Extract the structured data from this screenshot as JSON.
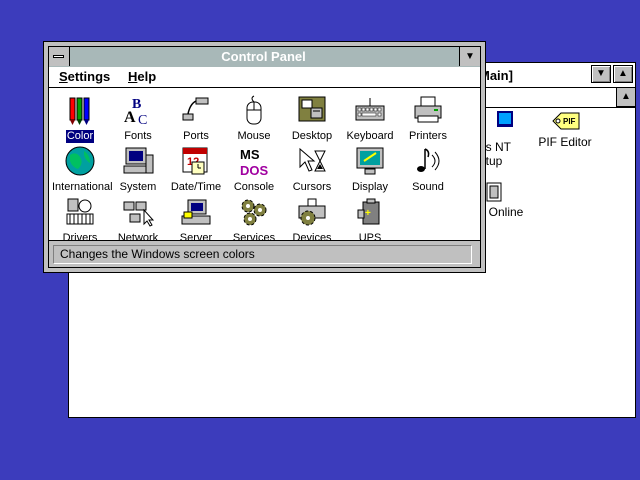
{
  "main_window": {
    "title": "Main]",
    "items": [
      {
        "label": "ws NT",
        "label2": "tup",
        "icon": "windows-nt-setup-icon"
      },
      {
        "label": "PIF Editor",
        "icon": "pif-editor-icon"
      },
      {
        "label": "Online",
        "icon": "online-help-icon"
      }
    ]
  },
  "control_panel": {
    "title": "Control Panel",
    "menu": [
      "Settings",
      "Help"
    ],
    "items": [
      {
        "label": "Color",
        "icon": "color-icon"
      },
      {
        "label": "Fonts",
        "icon": "fonts-icon"
      },
      {
        "label": "Ports",
        "icon": "ports-icon"
      },
      {
        "label": "Mouse",
        "icon": "mouse-icon"
      },
      {
        "label": "Desktop",
        "icon": "desktop-icon"
      },
      {
        "label": "Keyboard",
        "icon": "keyboard-icon"
      },
      {
        "label": "Printers",
        "icon": "printers-icon"
      },
      {
        "label": "International",
        "icon": "globe-icon"
      },
      {
        "label": "System",
        "icon": "system-icon"
      },
      {
        "label": "Date/Time",
        "icon": "calendar-clock-icon"
      },
      {
        "label": "Console",
        "icon": "ms-dos-console-icon"
      },
      {
        "label": "Cursors",
        "icon": "cursor-hourglass-icon"
      },
      {
        "label": "Display",
        "icon": "display-icon"
      },
      {
        "label": "Sound",
        "icon": "sound-icon"
      },
      {
        "label": "Drivers",
        "icon": "drivers-icon"
      },
      {
        "label": "Network",
        "icon": "network-icon"
      },
      {
        "label": "Server",
        "icon": "server-icon"
      },
      {
        "label": "Services",
        "icon": "services-gears-icon"
      },
      {
        "label": "Devices",
        "icon": "devices-icon"
      },
      {
        "label": "UPS",
        "icon": "ups-battery-icon"
      }
    ],
    "selected_item": "Color",
    "status": "Changes the Windows screen colors"
  },
  "colors": {
    "desktop": "#3c3cbc",
    "titlebar_inactive": "#a8b8b8",
    "selection": "#000080"
  }
}
